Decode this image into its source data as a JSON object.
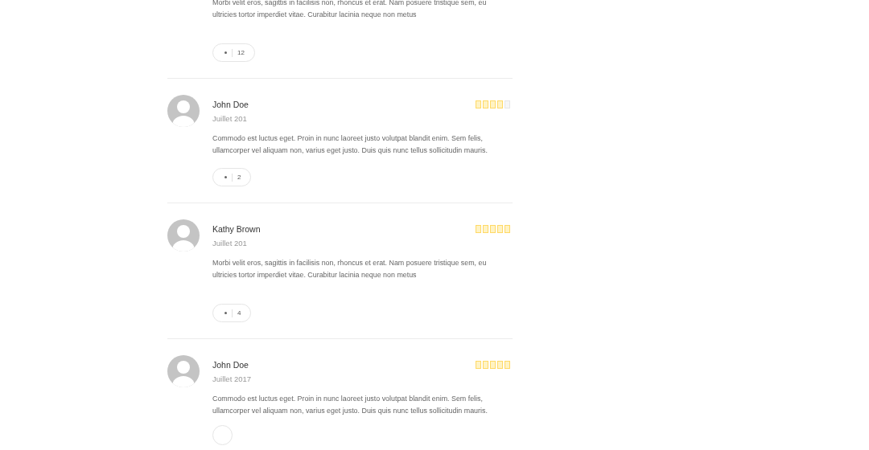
{
  "reviews": [
    {
      "kind": "partial",
      "text": "Morbi velit eros, sagittis in facilisis non, rhoncus et erat. Nam posuere tristique sem, eu ultricies tortor imperdiet vitae. Curabitur lacinia neque non metus",
      "likes": "12"
    },
    {
      "kind": "full",
      "name": "John Doe",
      "date": "Juillet 201",
      "stars": 4,
      "text": "Commodo est luctus eget. Proin in nunc laoreet justo volutpat blandit enim. Sem felis, ullamcorper vel aliquam non, varius eget justo. Duis quis nunc tellus sollicitudin mauris.",
      "likes": "2"
    },
    {
      "kind": "full",
      "name": "Kathy Brown",
      "date": "Juillet 201",
      "stars": 5,
      "text": "Morbi velit eros, sagittis in facilisis non, rhoncus et erat. Nam posuere tristique sem, eu ultricies tortor imperdiet vitae. Curabitur lacinia neque non metus",
      "likes": "4"
    },
    {
      "kind": "full",
      "name": "John Doe",
      "date": "Juillet 2017",
      "stars": 5,
      "text": "Commodo est luctus eget. Proin in nunc laoreet justo volutpat blandit enim. Sem felis, ullamcorper vel aliquam non, varius eget justo. Duis quis nunc tellus sollicitudin mauris."
    }
  ]
}
